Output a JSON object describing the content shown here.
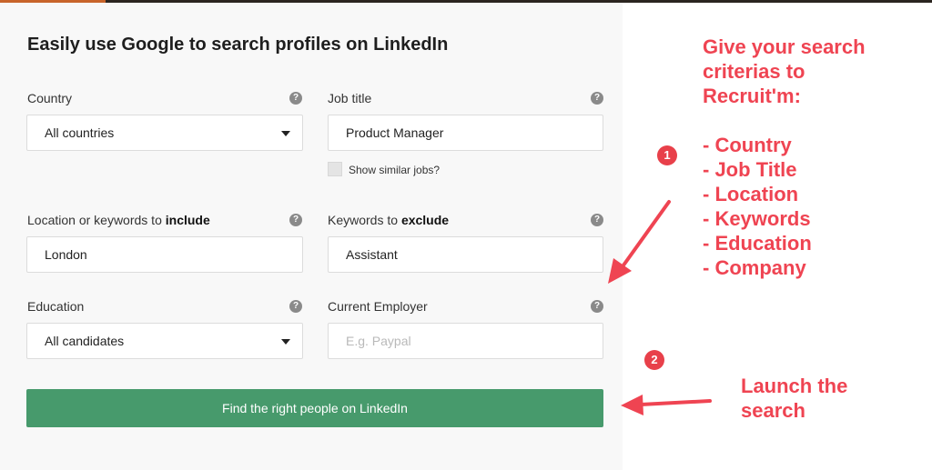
{
  "form": {
    "title": "Easily use Google to search profiles on LinkedIn",
    "help_glyph": "?",
    "country": {
      "label": "Country",
      "value": "All countries"
    },
    "job_title": {
      "label": "Job title",
      "value": "Product Manager",
      "similar_label": "Show similar jobs?"
    },
    "location": {
      "label_prefix": "Location or keywords to ",
      "label_bold": "include",
      "value": "London"
    },
    "exclude": {
      "label_prefix": "Keywords to ",
      "label_bold": "exclude",
      "value": "Assistant"
    },
    "education": {
      "label": "Education",
      "value": "All candidates"
    },
    "employer": {
      "label": "Current Employer",
      "placeholder": "E.g. Paypal"
    },
    "submit_label": "Find the right people on LinkedIn"
  },
  "annotations": {
    "colors": {
      "annotation": "#ef4452",
      "button": "#479a6c"
    },
    "criteria_heading": [
      "Give your search",
      "criterias to",
      "Recruit'm:"
    ],
    "criteria_items": [
      "- Country",
      "- Job Title",
      "- Location",
      "- Keywords",
      "- Education",
      "- Company"
    ],
    "badge_1": "1",
    "badge_2": "2",
    "launch_text": [
      "Launch the",
      "search"
    ]
  }
}
